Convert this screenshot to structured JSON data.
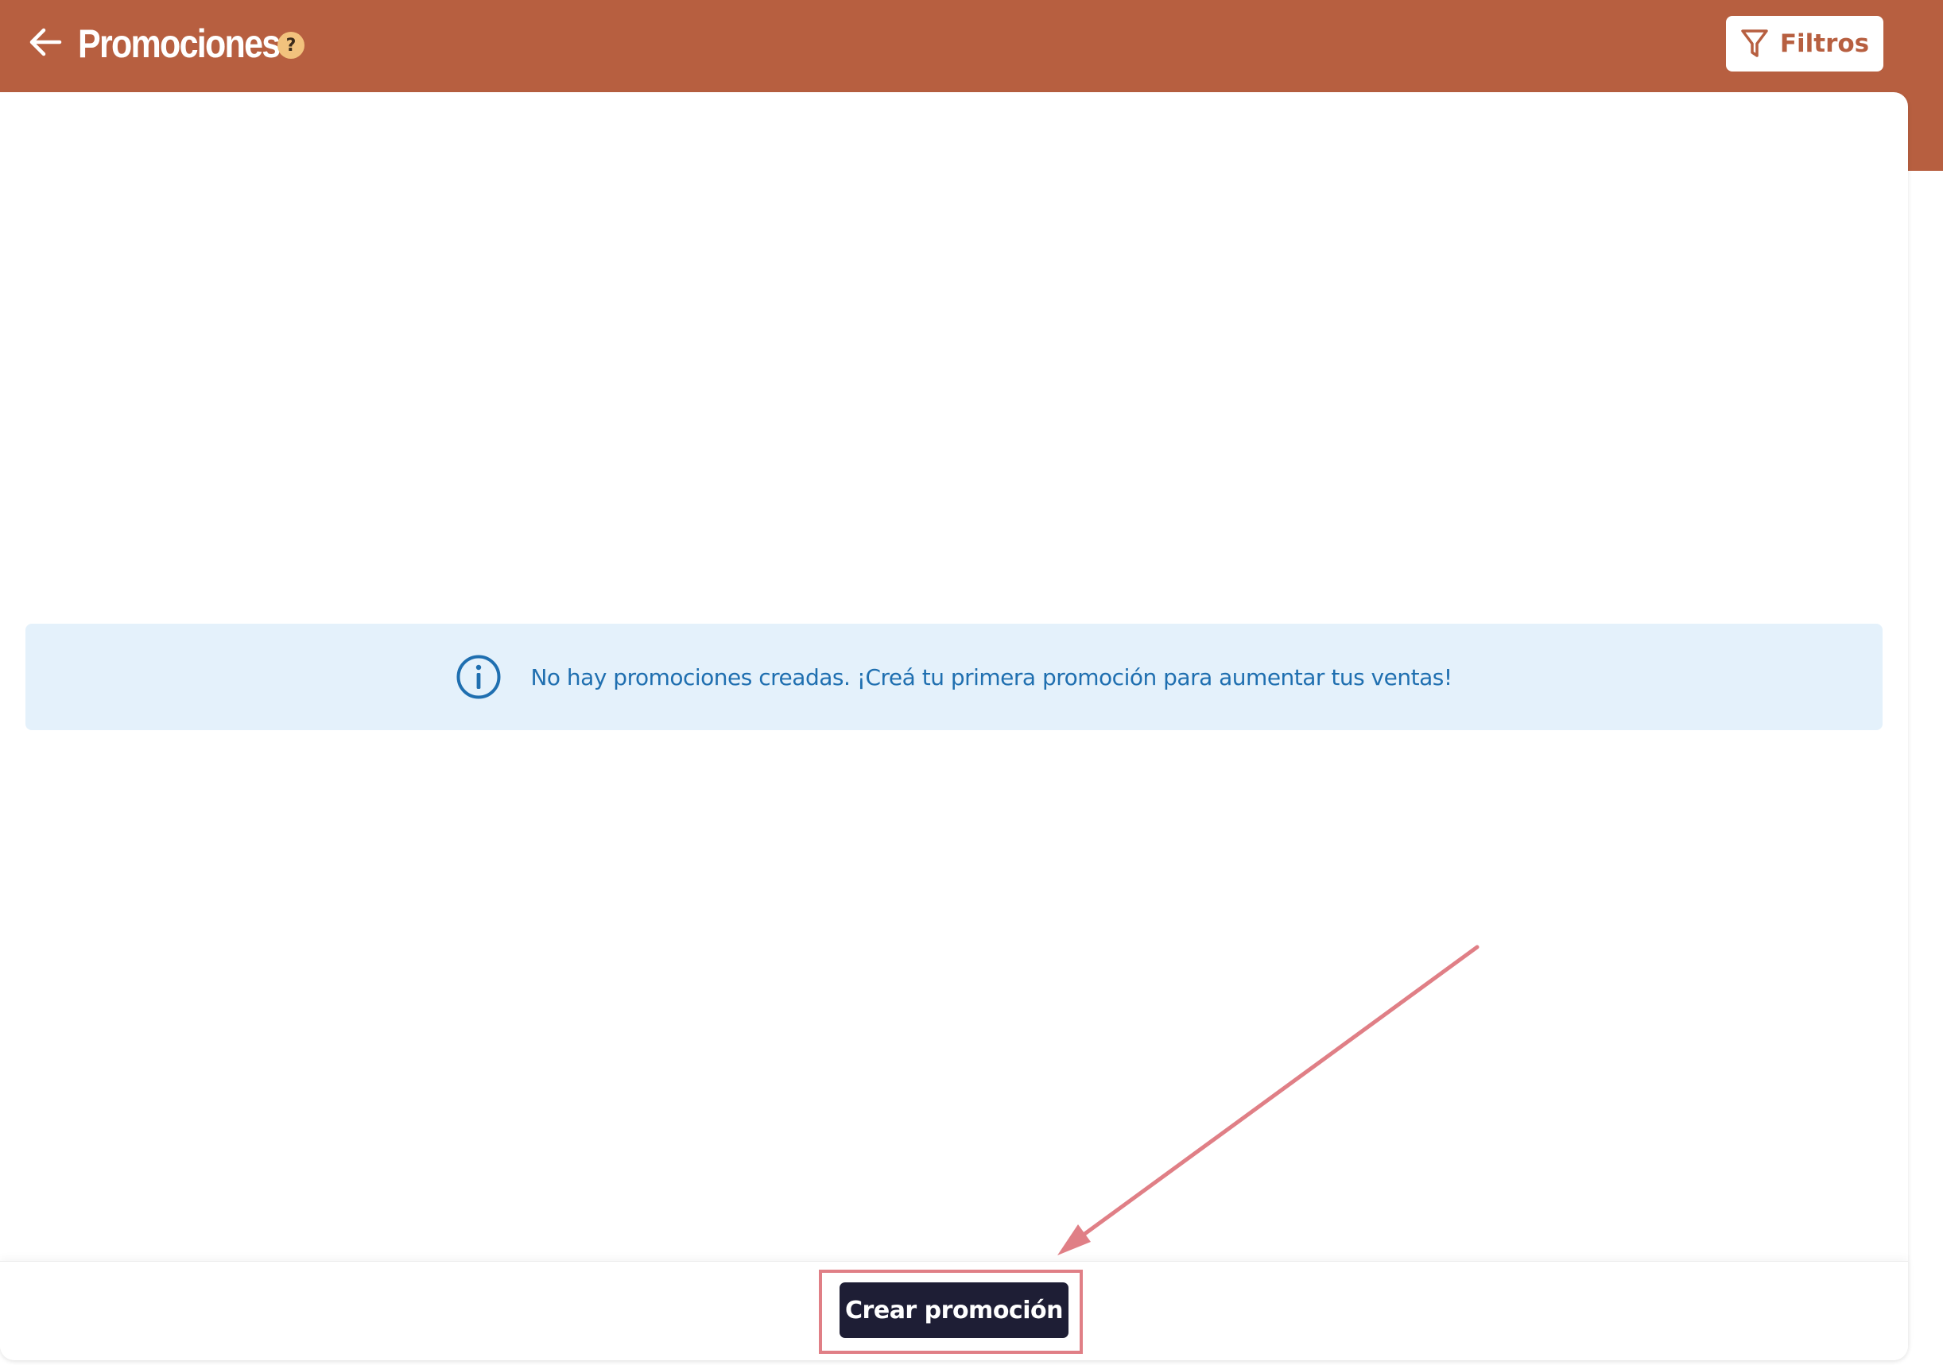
{
  "header": {
    "title": "Promociones",
    "help_glyph": "?",
    "filter_label": "Filtros",
    "back_icon": "arrow-left-icon",
    "filter_icon": "funnel-icon"
  },
  "main": {
    "empty_message": "No hay promociones creadas. ¡Creá tu primera promoción para aumentar tus ventas!",
    "info_icon": "info-circle-icon"
  },
  "footer": {
    "create_label": "Crear promoción"
  },
  "colors": {
    "header_bg": "#b75f40",
    "info_bg": "#e4f1fb",
    "info_text": "#1f6fb0",
    "primary_button": "#1e1e35",
    "annotation": "#e07f86",
    "help_badge": "#f2c27d"
  }
}
